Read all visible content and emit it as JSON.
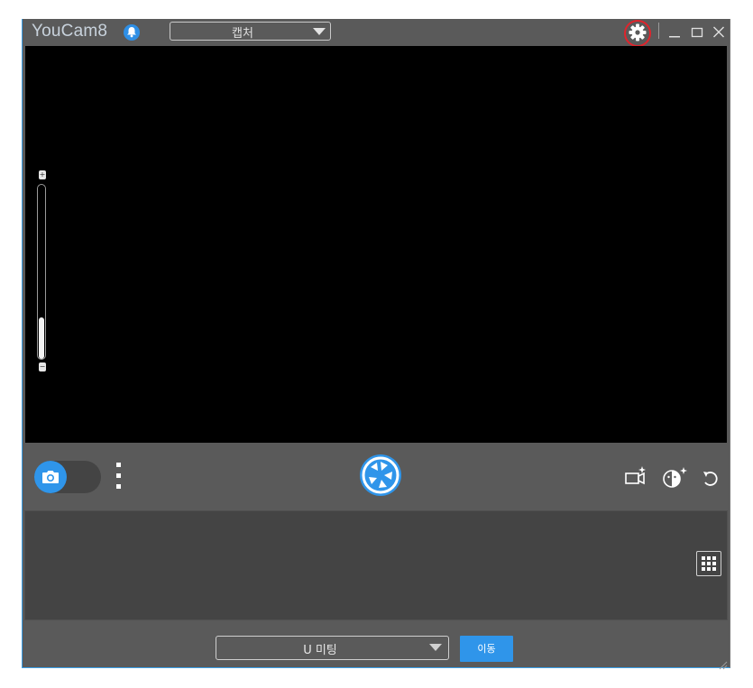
{
  "app": {
    "title": "YouCam8",
    "accent_color": "#2f95ea"
  },
  "titlebar": {
    "mode_select_value": "캡처",
    "icons": [
      "bell-icon",
      "gear-icon",
      "minimize-icon",
      "maximize-icon",
      "close-icon"
    ]
  },
  "zoom": {
    "plus_label": "+",
    "minus_label": "−",
    "level": 0.22
  },
  "controls": {
    "mode_toggle_state": "photo",
    "icons": [
      "camera-icon",
      "more-icon",
      "shutter-icon",
      "video-effects-icon",
      "face-effects-icon",
      "undo-icon"
    ]
  },
  "tray": {
    "icons": [
      "grid-icon"
    ]
  },
  "footer": {
    "meeting_select_value": "U 미팅",
    "go_button_label": "이동"
  }
}
